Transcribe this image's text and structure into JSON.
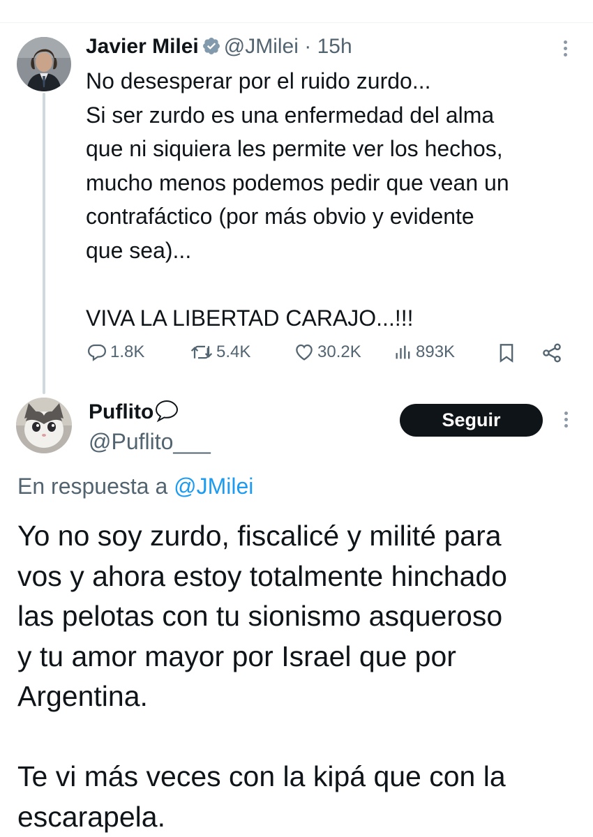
{
  "tweet": {
    "author_name": "Javier Milei",
    "handle": "@JMilei",
    "separator": "·",
    "time": "15h",
    "text": "No desesperar por el ruido zurdo...\nSi ser zurdo es una enfermedad del alma\nque ni siquiera les permite ver los hechos,\nmucho menos podemos pedir que vean un\ncontrafáctico (por más obvio y evidente\nque sea)...\n\nVIVA LA LIBERTAD CARAJO...!!!",
    "replies": "1.8K",
    "retweets": "5.4K",
    "likes": "30.2K",
    "views": "893K",
    "icons": [
      "verified-badge-icon",
      "more-icon",
      "reply-icon",
      "retweet-icon",
      "like-icon",
      "views-icon",
      "bookmark-icon",
      "share-icon"
    ]
  },
  "reply": {
    "author_name": "Puflito",
    "handle": "@Puflito___",
    "follow_label": "Seguir",
    "in_reply_prefix": "En respuesta a",
    "in_reply_handle": "@JMilei",
    "text": "Yo no soy zurdo, fiscalicé y milité para\nvos y ahora estoy totalmente hinchado\nlas pelotas con tu sionismo asqueroso\ny tu amor mayor por Israel que por\nArgentina.\n\nTe vi más veces con la kipá que con la\nescarapela.",
    "icons": [
      "speech-bubble-icon",
      "more-icon"
    ]
  },
  "colors": {
    "text": "#0f1419",
    "secondary": "#536471",
    "link": "#1d9bf0",
    "verified_badge": "#829aab",
    "follow_button_bg": "#0f1419",
    "thread_line": "#cfd9de"
  }
}
